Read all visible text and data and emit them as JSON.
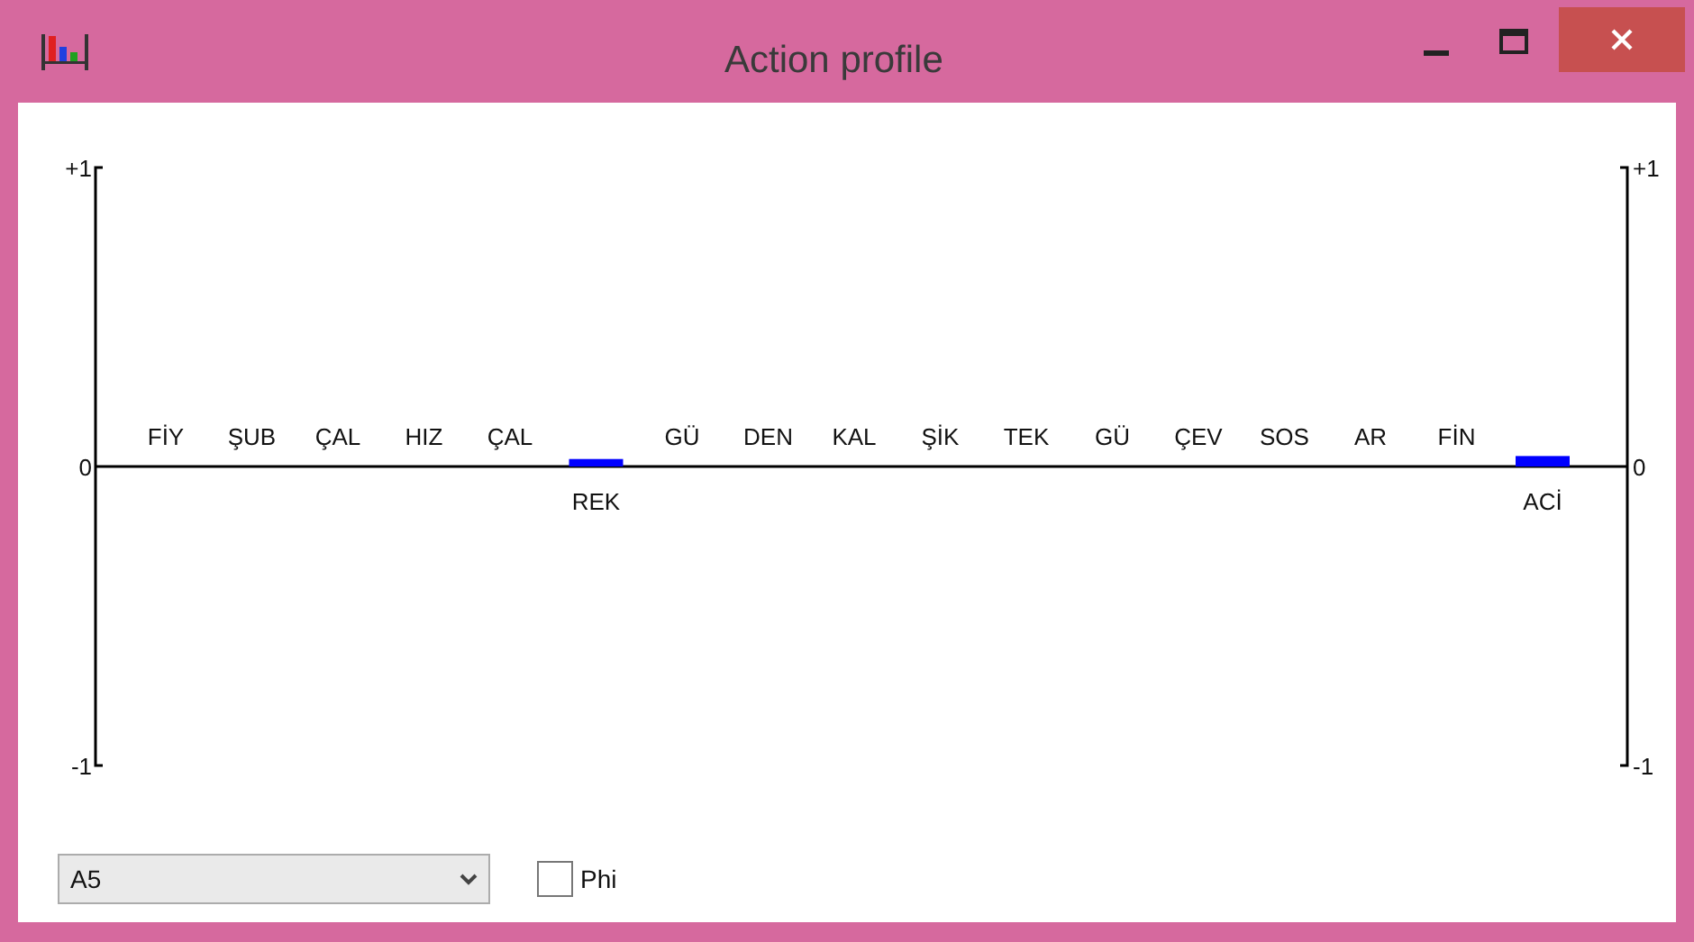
{
  "window": {
    "title": "Action profile"
  },
  "chart": {
    "chart_data": {
      "type": "bar",
      "categories": [
        "FİY",
        "ŞUB",
        "ÇAL",
        "HIZ",
        "ÇAL",
        "REK",
        "GÜ",
        "DEN",
        "KAL",
        "ŞİK",
        "TEK",
        "GÜ",
        "ÇEV",
        "SOS",
        "AR",
        "FİN",
        "ACİ"
      ],
      "series": [
        {
          "color": "#0000ff",
          "values": [
            0,
            0,
            0,
            0,
            0,
            0.025,
            0,
            0,
            0,
            0,
            0,
            0,
            0,
            0,
            0,
            0,
            0.035
          ]
        }
      ],
      "ylim": [
        -1,
        1
      ],
      "yticks": [
        {
          "value": 1,
          "label": "+1"
        },
        {
          "value": 0,
          "label": "0"
        },
        {
          "value": -1,
          "label": "-1"
        }
      ]
    },
    "right_axis": {
      "tick_labels": [
        "+1",
        "0",
        "-1"
      ]
    }
  },
  "controls": {
    "profile_select": {
      "value": "A5"
    },
    "phi": {
      "label": "Phi",
      "checked": false
    }
  }
}
